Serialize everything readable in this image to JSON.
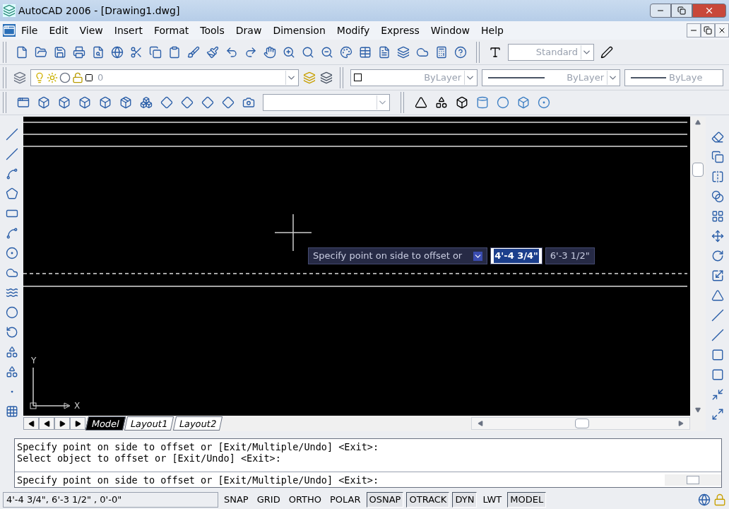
{
  "window": {
    "title": "AutoCAD 2006 - [Drawing1.dwg]"
  },
  "menu": [
    "File",
    "Edit",
    "View",
    "Insert",
    "Format",
    "Tools",
    "Draw",
    "Dimension",
    "Modify",
    "Express",
    "Window",
    "Help"
  ],
  "toolbars": {
    "text_style": "Standard",
    "layer": "0",
    "color_setting": "ByLayer",
    "linetype": "ByLayer",
    "lineweight": "ByLaye"
  },
  "canvas": {
    "tooltip": {
      "prompt": "Specify point on side to offset or",
      "value": "4'-4 3/4\"",
      "second_value": "6'-3 1/2\""
    },
    "ucs": {
      "x_label": "X",
      "y_label": "Y"
    }
  },
  "layout_tabs": [
    {
      "label": "Model",
      "selected": true
    },
    {
      "label": "Layout1",
      "selected": false
    },
    {
      "label": "Layout2",
      "selected": false
    }
  ],
  "command_history": [
    "Specify point on side to offset or [Exit/Multiple/Undo] <Exit>:",
    "Select object to offset or [Exit/Undo] <Exit>:"
  ],
  "command_line": "Specify point on side to offset or [Exit/Multiple/Undo] <Exit>:",
  "status_bar": {
    "coordinates": "4'-4 3/4\", 6'-3 1/2\" , 0'-0\"",
    "toggles": [
      {
        "label": "SNAP",
        "on": false
      },
      {
        "label": "GRID",
        "on": false
      },
      {
        "label": "ORTHO",
        "on": false
      },
      {
        "label": "POLAR",
        "on": false
      },
      {
        "label": "OSNAP",
        "on": true
      },
      {
        "label": "OTRACK",
        "on": true
      },
      {
        "label": "DYN",
        "on": true
      },
      {
        "label": "LWT",
        "on": false
      },
      {
        "label": "MODEL",
        "on": true
      }
    ]
  }
}
